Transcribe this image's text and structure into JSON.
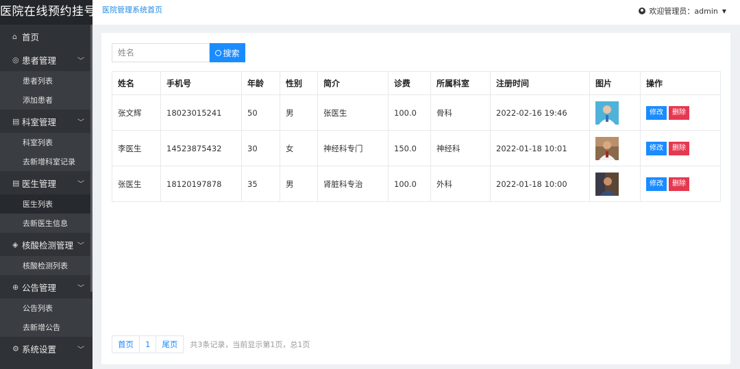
{
  "app": {
    "title": "医院在线预约挂号"
  },
  "header": {
    "breadcrumb": "医院管理系统首页",
    "user": "欢迎管理员：admin"
  },
  "sidebar": {
    "home": "首页",
    "patient": {
      "label": "患者管理",
      "items": [
        "患者列表",
        "添加患者"
      ]
    },
    "dept": {
      "label": "科室管理",
      "items": [
        "科室列表",
        "去新增科室记录"
      ]
    },
    "doctor": {
      "label": "医生管理",
      "items": [
        "医生列表",
        "去新医生信息"
      ]
    },
    "nucleic": {
      "label": "核酸检测管理",
      "items": [
        "核酸检测列表"
      ]
    },
    "notice": {
      "label": "公告管理",
      "items": [
        "公告列表",
        "去新增公告"
      ]
    },
    "settings": {
      "label": "系统设置"
    }
  },
  "search": {
    "placeholder": "姓名",
    "button": "搜索"
  },
  "table": {
    "headers": [
      "姓名",
      "手机号",
      "年龄",
      "性别",
      "简介",
      "诊费",
      "所属科室",
      "注册时间",
      "图片",
      "操作"
    ],
    "rows": [
      {
        "name": "张文辉",
        "phone": "18023015241",
        "age": "50",
        "gender": "男",
        "intro": "张医生",
        "fee": "100.0",
        "dept": "骨科",
        "time": "2022-02-16 19:46"
      },
      {
        "name": "李医生",
        "phone": "14523875432",
        "age": "30",
        "gender": "女",
        "intro": "神经科专门",
        "fee": "150.0",
        "dept": "神经科",
        "time": "2022-01-18 10:01"
      },
      {
        "name": "张医生",
        "phone": "18120197878",
        "age": "35",
        "gender": "男",
        "intro": "肾脏科专治",
        "fee": "100.0",
        "dept": "外科",
        "time": "2022-01-18 10:00"
      }
    ],
    "edit": "修改",
    "delete": "删除"
  },
  "pager": {
    "first": "首页",
    "page": "1",
    "last": "尾页",
    "info": "共3条记录，当前显示第1页，总1页"
  }
}
